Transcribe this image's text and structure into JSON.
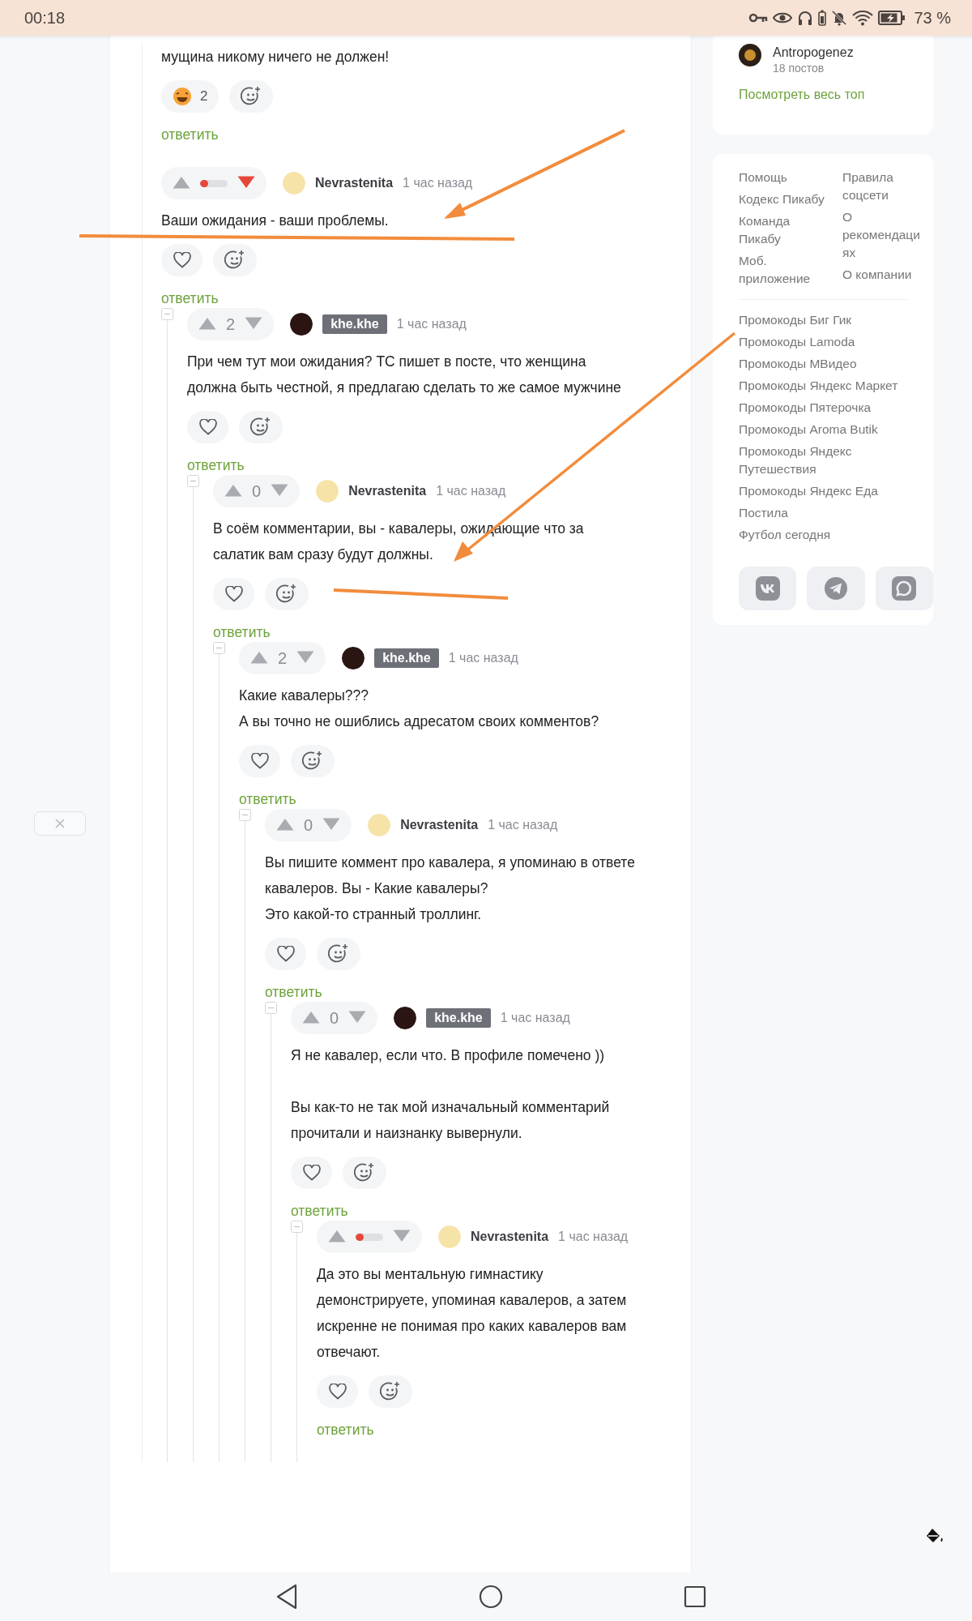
{
  "status_bar": {
    "time": "00:18",
    "battery": "73 %"
  },
  "comments": [
    {
      "text": "мущина никому ничего не должен!",
      "reactions": [
        {
          "kind": "laugh",
          "count": "2"
        }
      ],
      "reply": "ответить"
    },
    {
      "author": "Nevrastenita",
      "name_badge": false,
      "avatar": {
        "color": "#f6e3a8"
      },
      "vote": {
        "kind": "bar",
        "level": 0.3,
        "downvoted": true
      },
      "time": "1 час назад",
      "text": "Ваши ожидания - ваши проблемы.",
      "reactions": [
        {
          "kind": "heart"
        }
      ],
      "reply": "ответить",
      "children": [
        {
          "expanded": true,
          "author": "khe.khe",
          "name_badge": true,
          "avatar": {
            "color": "#2a1512"
          },
          "vote": {
            "kind": "score",
            "score": "2",
            "downvoted": false
          },
          "time": "1 час назад",
          "text": "При чем тут мои ожидания? ТС пишет в посте, что женщина должна быть честной, я предлагаю сделать то же самое мужчине",
          "reactions": [
            {
              "kind": "heart"
            }
          ],
          "reply": "ответить",
          "children": [
            {
              "expanded": true,
              "author": "Nevrastenita",
              "name_badge": false,
              "avatar": {
                "color": "#f6e3a8"
              },
              "vote": {
                "kind": "score",
                "score": "0",
                "downvoted": false
              },
              "time": "1 час назад",
              "text": "В соём комментарии, вы - кавалеры, ожидающие что за салатик вам сразу будут должны.",
              "reactions": [
                {
                  "kind": "heart"
                }
              ],
              "reply": "ответить",
              "children": [
                {
                  "expanded": true,
                  "author": "khe.khe",
                  "name_badge": true,
                  "avatar": {
                    "color": "#2a1512"
                  },
                  "vote": {
                    "kind": "score",
                    "score": "2",
                    "downvoted": false
                  },
                  "time": "1 час назад",
                  "text": "Какие кавалеры???\nА вы точно не ошиблись адресатом своих комментов?",
                  "reactions": [
                    {
                      "kind": "heart"
                    }
                  ],
                  "reply": "ответить",
                  "children": [
                    {
                      "expanded": true,
                      "author": "Nevrastenita",
                      "name_badge": false,
                      "avatar": {
                        "color": "#f6e3a8"
                      },
                      "vote": {
                        "kind": "score",
                        "score": "0",
                        "downvoted": false
                      },
                      "time": "1 час назад",
                      "text": "Вы пишите коммент про кавалера, я упоминаю в ответе кавалеров. Вы - Какие кавалеры?\nЭто какой-то странный троллинг.",
                      "reactions": [
                        {
                          "kind": "heart"
                        }
                      ],
                      "reply": "ответить",
                      "children": [
                        {
                          "expanded": true,
                          "author": "khe.khe",
                          "name_badge": true,
                          "avatar": {
                            "color": "#2a1512"
                          },
                          "vote": {
                            "kind": "score",
                            "score": "0",
                            "downvoted": false
                          },
                          "time": "1 час назад",
                          "text": "Я не кавалер, если что. В профиле помечено ))\n\nВы как-то не так мой изначальный комментарий прочитали и наизнанку вывернули.",
                          "reactions": [
                            {
                              "kind": "heart"
                            }
                          ],
                          "reply": "ответить",
                          "children": [
                            {
                              "expanded": true,
                              "author": "Nevrastenita",
                              "name_badge": false,
                              "avatar": {
                                "color": "#f6e3a8"
                              },
                              "vote": {
                                "kind": "bar",
                                "level": 0.3,
                                "downvoted": false
                              },
                              "time": "1 час назад",
                              "text": "Да это вы ментальную гимнастику демонстрируете, упоминая кавалеров, а затем искренне не понимая про каких кавалеров вам отвечают.",
                              "reactions": [
                                {
                                  "kind": "heart"
                                }
                              ],
                              "reply": "ответить"
                            }
                          ]
                        }
                      ]
                    }
                  ]
                }
              ]
            }
          ]
        }
      ]
    }
  ],
  "sidebar": {
    "top_card": {
      "user": {
        "name": "Antropogenez",
        "posts": "18 постов"
      },
      "link": "Посмотреть весь топ"
    },
    "links_card": {
      "columns": [
        [
          "Помощь",
          "Кодекс Пикабу",
          "Команда Пикабу",
          "Моб. приложение"
        ],
        [
          "Правила соцсети",
          "О рекомендациях",
          "О компании"
        ]
      ],
      "promo_links": [
        "Промокоды Биг Гик",
        "Промокоды Lamoda",
        "Промокоды МВидео",
        "Промокоды Яндекс Маркет",
        "Промокоды Пятерочка",
        "Промокоды Aroma Butik",
        "Промокоды Яндекс Путешествия",
        "Промокоды Яндекс Еда",
        "Постила",
        "Футбол сегодня"
      ],
      "social": [
        {
          "kind": "vk"
        },
        {
          "kind": "telegram"
        },
        {
          "kind": "chat"
        }
      ]
    }
  }
}
